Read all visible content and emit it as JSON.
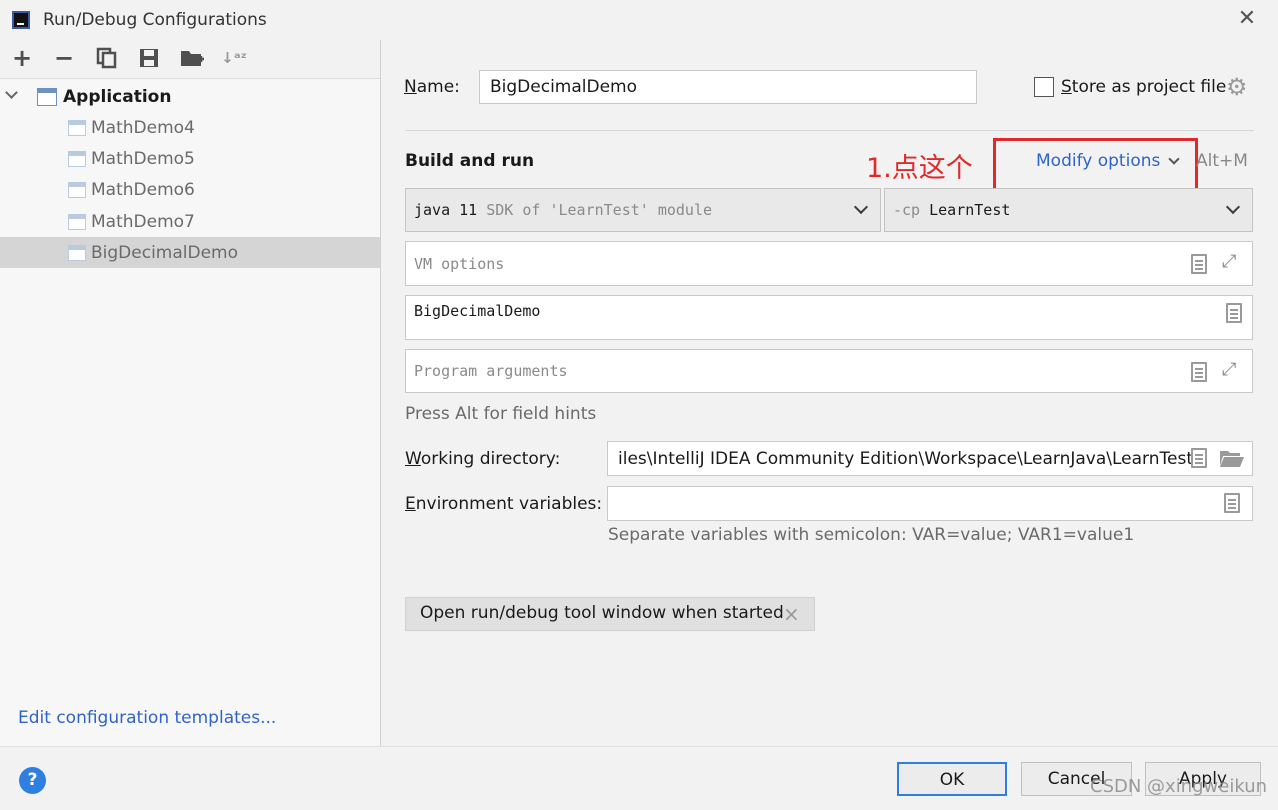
{
  "window": {
    "title": "Run/Debug Configurations",
    "close_symbol": "✕"
  },
  "toolbar": {
    "icons": [
      "add-icon",
      "remove-icon",
      "copy-icon",
      "save-icon",
      "folder-add-icon",
      "sort-icon"
    ]
  },
  "tree": {
    "group_label": "Application",
    "items": [
      {
        "label": "MathDemo4"
      },
      {
        "label": "MathDemo5"
      },
      {
        "label": "MathDemo6"
      },
      {
        "label": "MathDemo7"
      },
      {
        "label": "BigDecimalDemo",
        "selected": true
      }
    ],
    "edit_templates_link": "Edit configuration templates..."
  },
  "form": {
    "name_label_first": "N",
    "name_label_rest": "ame:",
    "name_value": "BigDecimalDemo",
    "store_as_project_first": "S",
    "store_as_project_rest": "tore as project file",
    "store_as_project_checked": false,
    "section_title": "Build and run",
    "annotation": "1.点这个",
    "modify_options": "Modify options",
    "modify_shortcut": "Alt+M",
    "jdk_main": "java 11",
    "jdk_detail": "SDK of 'LearnTest' module",
    "cp_prefix": "-cp",
    "cp_value": "LearnTest",
    "vm_options_placeholder": "VM options",
    "main_class_value": "BigDecimalDemo",
    "program_args_placeholder": "Program arguments",
    "field_hint": "Press Alt for field hints",
    "working_dir_label_first": "W",
    "working_dir_label_rest": "orking directory:",
    "working_dir_value": "iles\\IntelliJ IDEA Community Edition\\Workspace\\LearnJava\\LearnTest",
    "env_label_first": "E",
    "env_label_rest": "nvironment variables:",
    "env_value": "",
    "env_hint": "Separate variables with semicolon: VAR=value; VAR1=value1",
    "tag_label": "Open run/debug tool window when started",
    "tag_close": "×"
  },
  "buttons": {
    "help": "?",
    "ok": "OK",
    "cancel": "Cancel",
    "apply": "Apply"
  },
  "watermark": "CSDN @xingweikun",
  "colors": {
    "link": "#2f64c6",
    "annotation": "#e02a2a",
    "selection": "#d5d5d5",
    "focus": "#2f7fe0"
  }
}
